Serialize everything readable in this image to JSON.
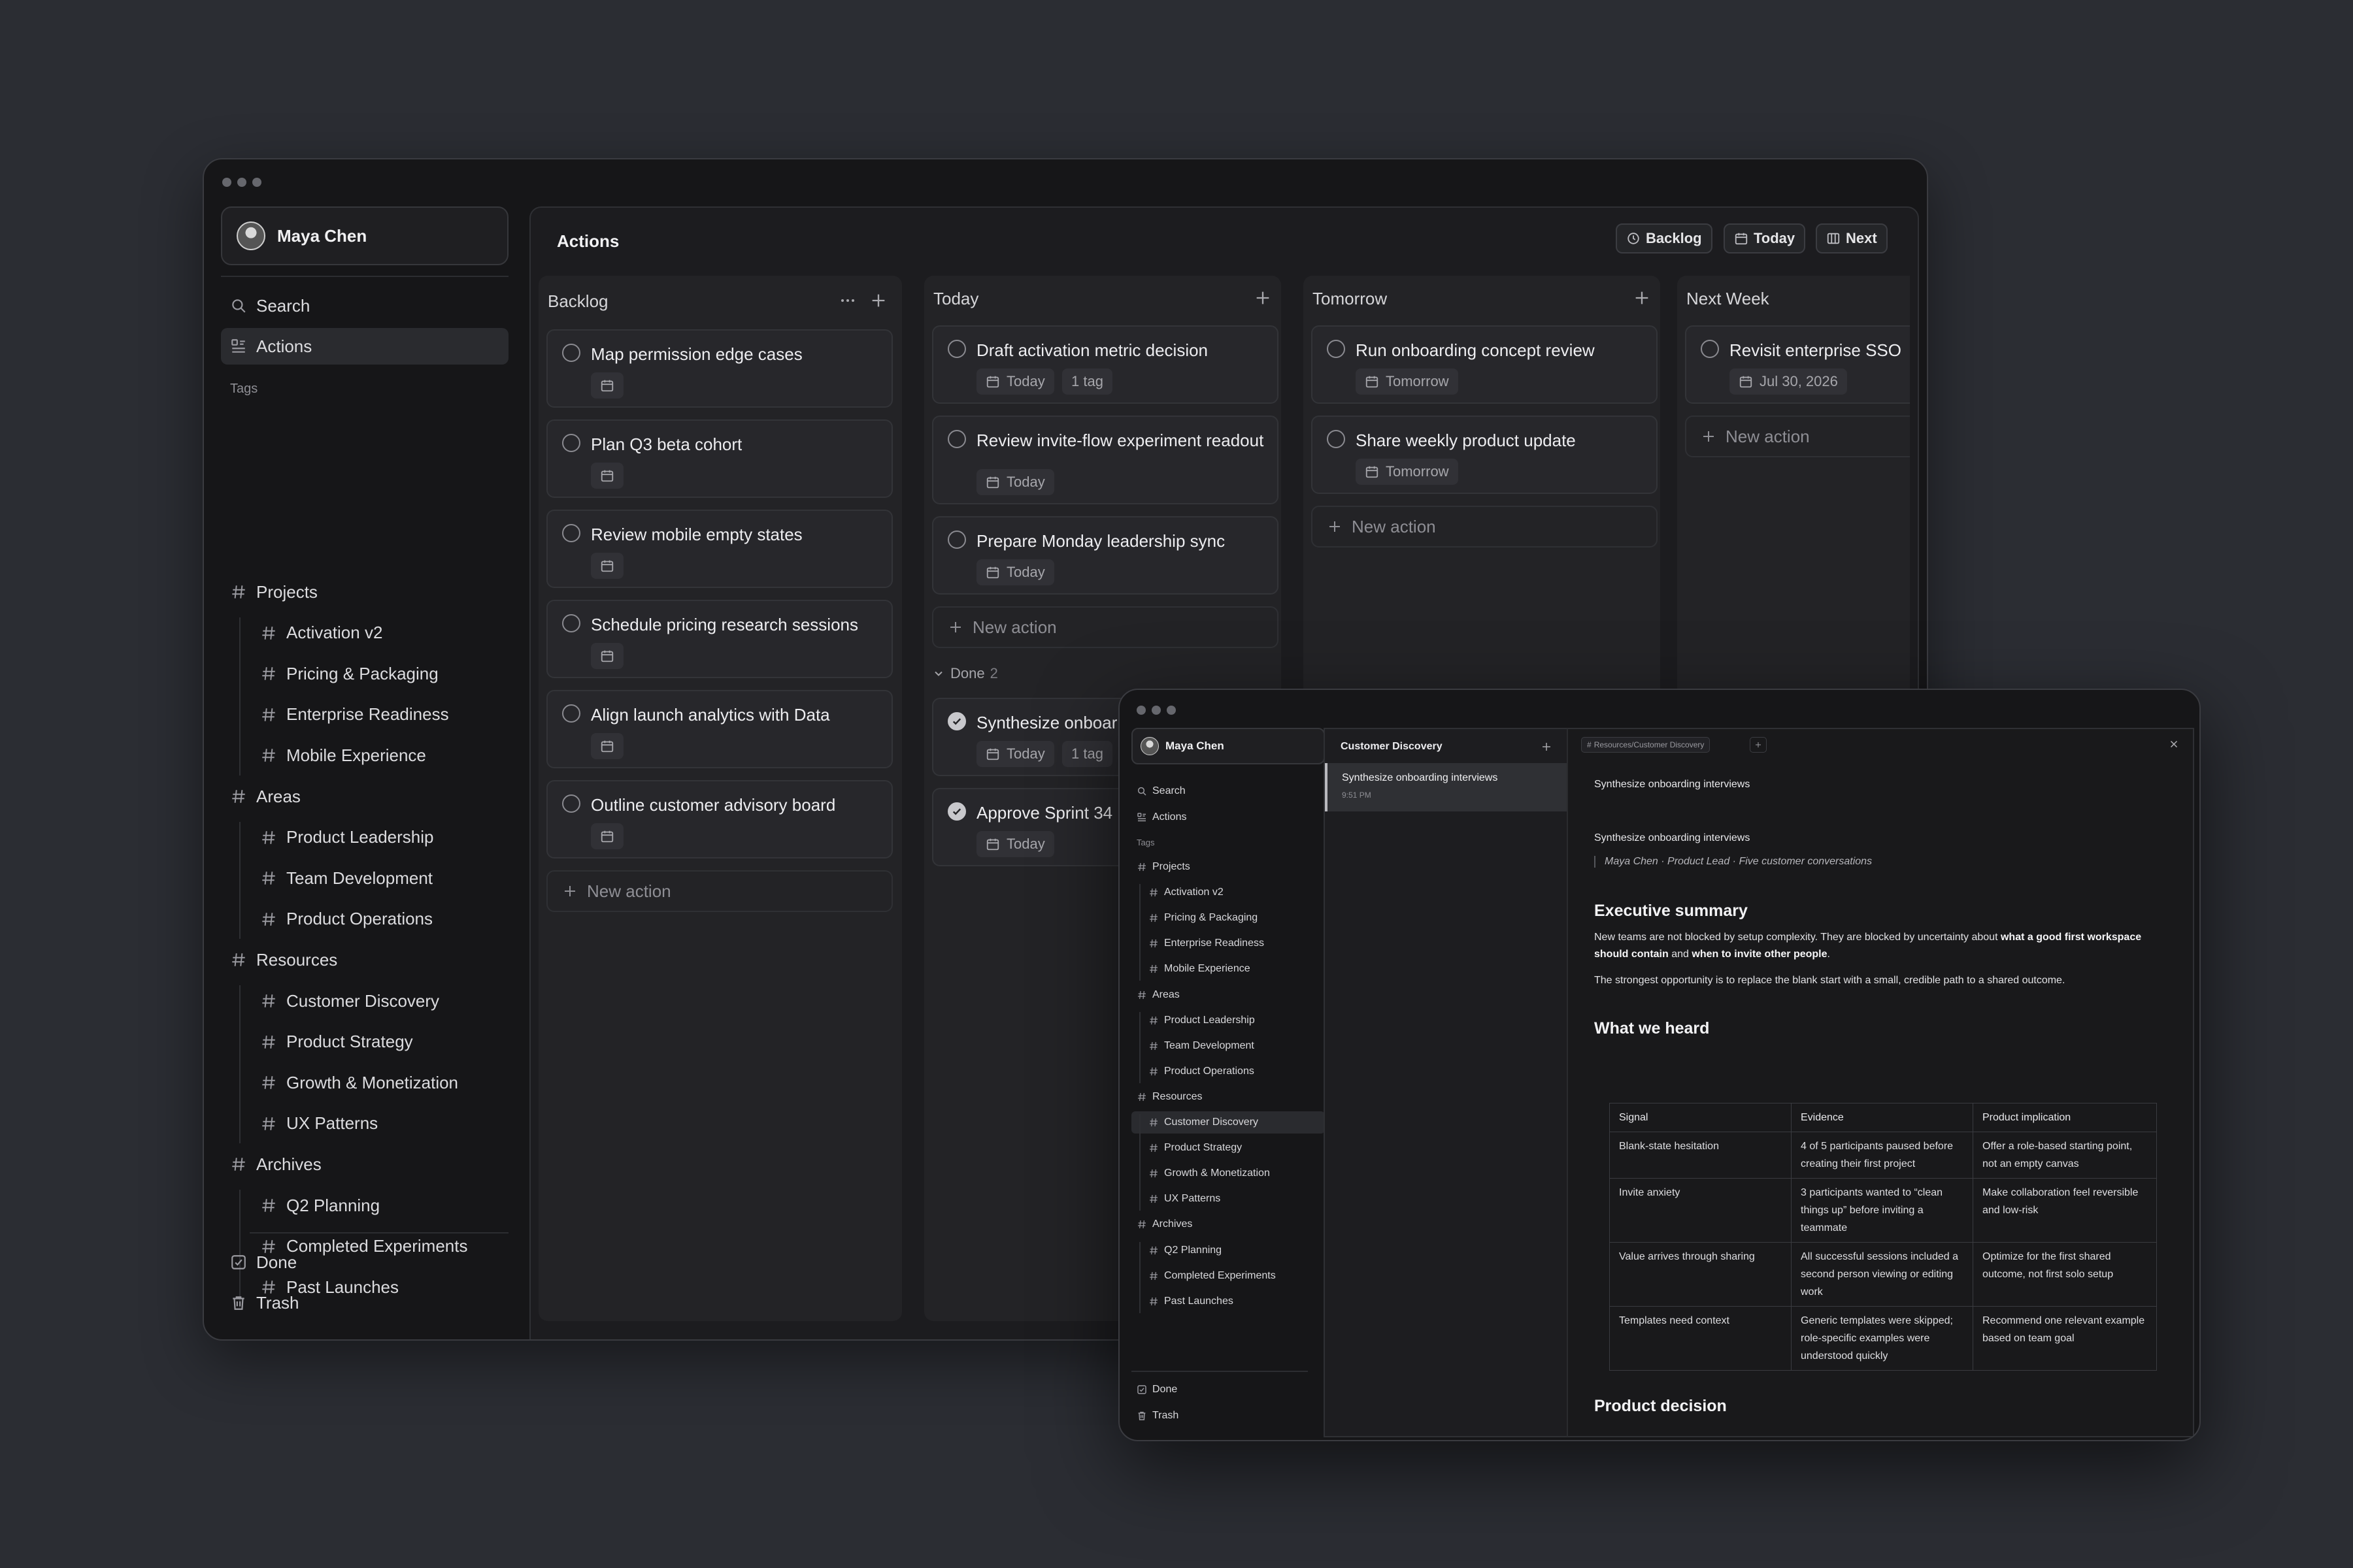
{
  "app": {
    "user": "Maya Chen"
  },
  "sidebar": {
    "search": "Search",
    "actions": "Actions",
    "tags_label": "Tags",
    "groups": [
      {
        "label": "Projects",
        "items": [
          "Activation v2",
          "Pricing & Packaging",
          "Enterprise Readiness",
          "Mobile Experience"
        ]
      },
      {
        "label": "Areas",
        "items": [
          "Product Leadership",
          "Team Development",
          "Product Operations"
        ]
      },
      {
        "label": "Resources",
        "items": [
          "Customer Discovery",
          "Product Strategy",
          "Growth & Monetization",
          "UX Patterns"
        ]
      },
      {
        "label": "Archives",
        "items": [
          "Q2 Planning",
          "Completed Experiments",
          "Past Launches"
        ]
      }
    ],
    "done": "Done",
    "trash": "Trash"
  },
  "main": {
    "title": "Actions",
    "header_buttons": [
      "Backlog",
      "Today",
      "Next"
    ],
    "new_action": "New action",
    "columns": [
      {
        "title": "Backlog",
        "cards": [
          {
            "text": "Map permission edge cases"
          },
          {
            "text": "Plan Q3 beta cohort"
          },
          {
            "text": "Review mobile empty states"
          },
          {
            "text": "Schedule pricing research sessions"
          },
          {
            "text": "Align launch analytics with Data"
          },
          {
            "text": "Outline customer advisory board"
          }
        ]
      },
      {
        "title": "Today",
        "cards": [
          {
            "text": "Draft activation metric decision",
            "date": "Today",
            "tag": "1 tag"
          },
          {
            "text": "Review invite-flow experiment readout",
            "date": "Today"
          },
          {
            "text": "Prepare Monday leadership sync",
            "date": "Today"
          }
        ],
        "done_label": "Done",
        "done_count": "2",
        "done_cards": [
          {
            "text": "Synthesize onboar",
            "date": "Today",
            "tag": "1 tag"
          },
          {
            "text": "Approve Sprint 34",
            "date": "Today"
          }
        ]
      },
      {
        "title": "Tomorrow",
        "cards": [
          {
            "text": "Run onboarding concept review",
            "date": "Tomorrow"
          },
          {
            "text": "Share weekly product update",
            "date": "Tomorrow"
          }
        ]
      },
      {
        "title": "Next Week",
        "cards": [
          {
            "text": "Revisit enterprise SSO",
            "date": "Jul 30, 2026"
          }
        ]
      }
    ]
  },
  "detail_window": {
    "user": "Maya Chen",
    "list_title": "Customer Discovery",
    "list_item": {
      "title": "Synthesize onboarding interviews",
      "time": "9:51 PM"
    },
    "breadcrumb": "Resources/Customer Discovery",
    "doc": {
      "heading_top": "Synthesize onboarding interviews",
      "title": "Synthesize onboarding interviews",
      "byline": "Maya Chen · Product Lead · Five customer conversations",
      "h_exec": "Executive summary",
      "p1_a": "New teams are not blocked by setup complexity. They are blocked by uncertainty about ",
      "p1_b": "what a good first workspace should contain",
      "p1_c": " and ",
      "p1_d": "when to invite other people",
      "p1_e": ".",
      "p2": "The strongest opportunity is to replace the blank start with a small, credible path to a shared outcome.",
      "h_heard": "What we heard",
      "table_headers": [
        "Signal",
        "Evidence",
        "Product implication"
      ],
      "table_rows": [
        [
          "Blank-state hesitation",
          "4 of 5 participants paused before creating their first project",
          "Offer a role-based starting point, not an empty canvas"
        ],
        [
          "Invite anxiety",
          "3 participants wanted to “clean things up” before inviting a teammate",
          "Make collaboration feel reversible and low-risk"
        ],
        [
          "Value arrives through sharing",
          "All successful sessions included a second person viewing or editing work",
          "Optimize for the first shared outcome, not first solo setup"
        ],
        [
          "Templates need context",
          "Generic templates were skipped; role-specific examples were understood quickly",
          "Recommend one relevant example based on team goal"
        ]
      ],
      "h_decision": "Product decision"
    }
  }
}
